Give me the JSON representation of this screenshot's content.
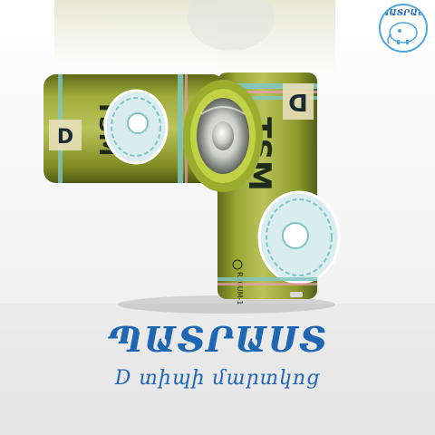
{
  "scene": {
    "description_colors": {
      "background": "#f4f4f4",
      "battery_olive": "#8c9a2b",
      "battery_stripe_teal": "#7fc6c3",
      "battery_stripe_pink": "#e79bb0",
      "text_blue": "#1f66b3"
    }
  },
  "battery": {
    "size_letter": "D",
    "brand": "TSM",
    "model_code": "R20UM-1",
    "mark": "TM"
  },
  "brand": {
    "title": "ՊԱՏՐԱՍՏ",
    "subtitle": "D տիպի մարտկոց",
    "badge_text": "ՊԱՏՐԱՍՏ",
    "badge_mark": "TM"
  }
}
